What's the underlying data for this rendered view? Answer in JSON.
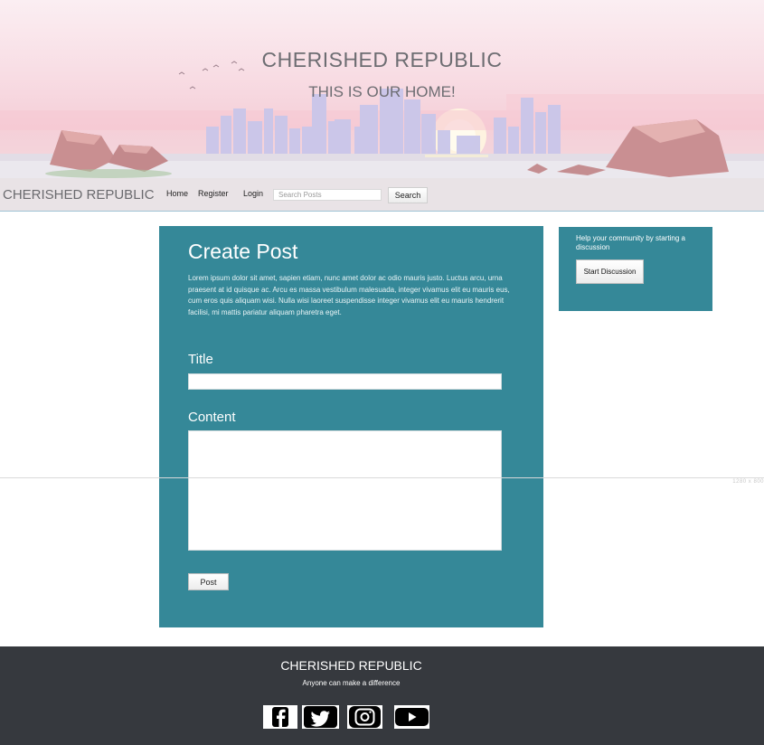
{
  "hero": {
    "title": "CHERISHED REPUBLIC",
    "subtitle": "THIS IS OUR HOME!"
  },
  "navbar": {
    "brand": "CHERISHED REPUBLIC",
    "links": [
      "Home",
      "Register",
      "Login"
    ],
    "search_placeholder": "Search Posts",
    "search_button": "Search"
  },
  "create_post": {
    "heading": "Create Post",
    "description": "Lorem ipsum dolor sit amet, sapien etiam, nunc amet dolor ac odio mauris justo. Luctus arcu, urna praesent at id quisque ac. Arcu es massa vestibulum malesuada, integer vivamus elit eu mauris eus, cum eros quis aliquam wisi. Nulla wisi laoreet suspendisse integer vivamus elit eu mauris hendrerit facilisi, mi mattis pariatur aliquam pharetra eget.",
    "title_label": "Title",
    "content_label": "Content",
    "post_button": "Post"
  },
  "sidebar": {
    "text": "Help your community by starting a discussion",
    "button": "Start Discussion"
  },
  "viewport_marker": "1280 x 800",
  "footer": {
    "title": "CHERISHED REPUBLIC",
    "tagline": "Anyone can make a difference",
    "social_icons": [
      "facebook-icon",
      "twitter-icon",
      "instagram-icon",
      "youtube-icon"
    ]
  },
  "colors": {
    "panel": "#358898",
    "footer": "#36393e",
    "hero_text": "#6d6d72"
  }
}
